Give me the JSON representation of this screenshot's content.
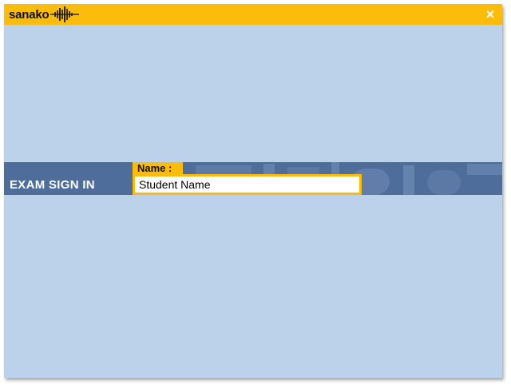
{
  "app": {
    "logo_text": "sanako",
    "logo_icon": "soundwave-icon",
    "close_label": "×",
    "close_icon": "close-icon"
  },
  "signin": {
    "heading": "EXAM SIGN IN",
    "name_label": "Name :",
    "name_value": "Student Name"
  },
  "colors": {
    "accent": "#fbbc0c",
    "background": "#bcd2ea",
    "band": "#4e6d9a"
  }
}
